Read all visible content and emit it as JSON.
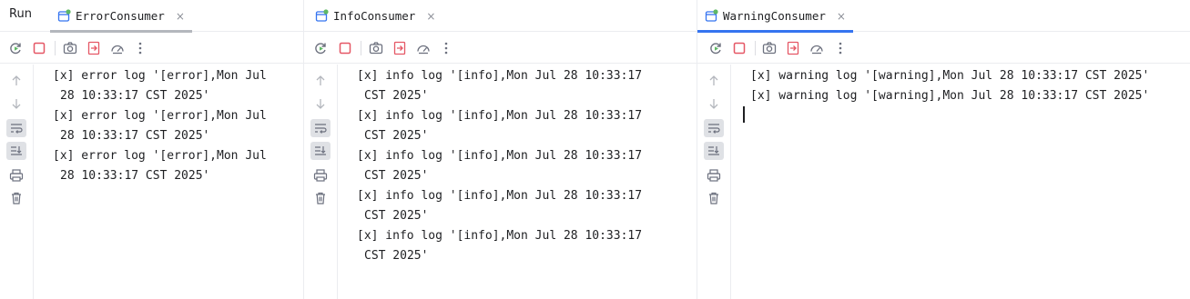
{
  "run_label": "Run",
  "panes": [
    {
      "tab": {
        "label": "ErrorConsumer",
        "close": "×",
        "active": false
      },
      "lines": [
        {
          "first": "[x] error log '[error],Mon Jul",
          "rest": "28 10:33:17 CST 2025'"
        },
        {
          "first": "[x] error log '[error],Mon Jul",
          "rest": "28 10:33:17 CST 2025'"
        },
        {
          "first": "[x] error log '[error],Mon Jul",
          "rest": "28 10:33:17 CST 2025'"
        }
      ]
    },
    {
      "tab": {
        "label": "InfoConsumer",
        "close": "×",
        "active": false
      },
      "lines": [
        {
          "first": "[x] info log '[info],Mon Jul 28 10:33:17",
          "rest": "CST 2025'"
        },
        {
          "first": "[x] info log '[info],Mon Jul 28 10:33:17",
          "rest": "CST 2025'"
        },
        {
          "first": "[x] info log '[info],Mon Jul 28 10:33:17",
          "rest": "CST 2025'"
        },
        {
          "first": "[x] info log '[info],Mon Jul 28 10:33:17",
          "rest": "CST 2025'"
        },
        {
          "first": "[x] info log '[info],Mon Jul 28 10:33:17",
          "rest": "CST 2025'"
        }
      ]
    },
    {
      "tab": {
        "label": "WarningConsumer",
        "close": "×",
        "active": true
      },
      "lines": [
        {
          "first": "[x] warning log '[warning],Mon Jul 28 10:33:17 CST 2025'",
          "rest": ""
        },
        {
          "first": "[x] warning log '[warning],Mon Jul 28 10:33:17 CST 2025'",
          "rest": ""
        }
      ]
    }
  ],
  "toolbar_icons": [
    "rerun-icon",
    "stop-icon",
    "screenshot-icon",
    "export-icon",
    "dashboard-icon",
    "more-icon"
  ],
  "gutter_icons": [
    "up-arrow-icon",
    "down-arrow-icon",
    "soft-wrap-icon",
    "scroll-to-end-icon",
    "print-icon",
    "trash-icon"
  ],
  "colors": {
    "accent": "#3574f0",
    "stop": "#e55765",
    "rerun": "#5fb865",
    "icon": "#6c707e"
  }
}
